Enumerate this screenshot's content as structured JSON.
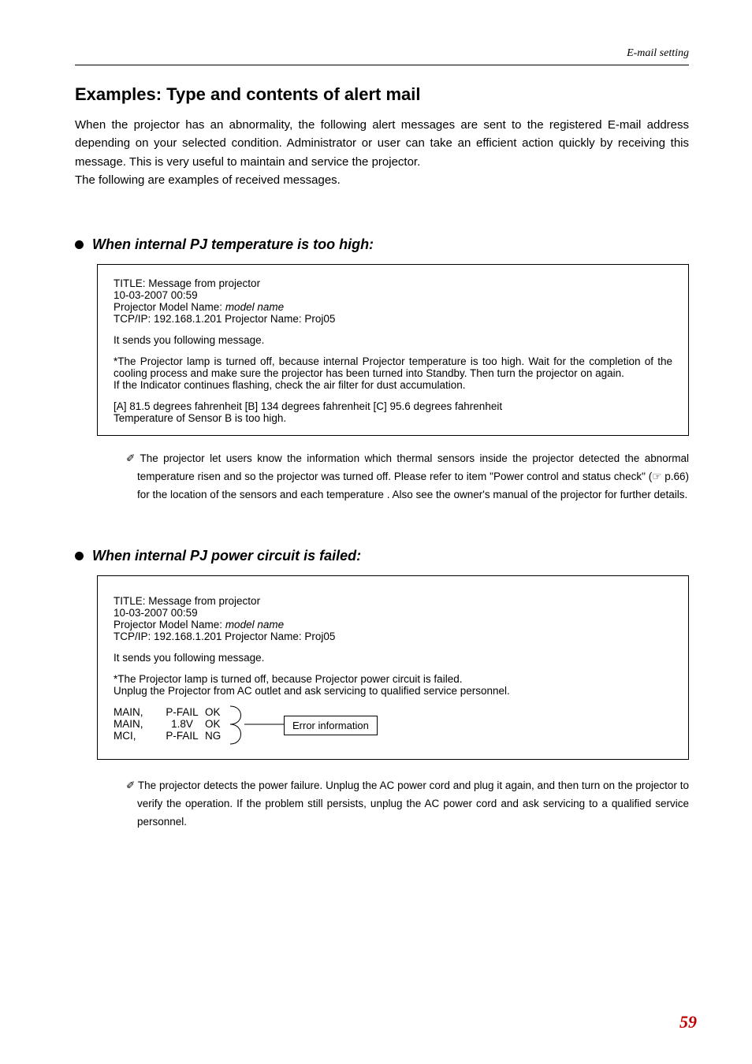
{
  "header": {
    "right_label": "E-mail setting"
  },
  "title": "Examples: Type and contents of alert mail",
  "intro": "When the projector has an abnormality, the following alert messages are sent to the registered E-mail address depending on your selected condition. Administrator or user can take an efficient action quickly by receiving this message. This is very useful to maintain and service the projector.\nThe following are examples of received messages.",
  "section1": {
    "heading": "When internal PJ temperature is too high:",
    "msg_title": "TITLE: Message from projector",
    "timestamp": "10-03-2007 00:59",
    "model_label": "Projector Model Name: ",
    "model_value": "model name",
    "tcpip": "TCP/IP: 192.168.1.201 Projector Name: Proj05",
    "sends": "It sends you following message.",
    "body": "*The Projector lamp is turned off, because internal Projector temperature is too high. Wait for the completion of the cooling process and make sure the projector has been turned into Standby. Then turn the projector on again.\n If the Indicator continues flashing, check the air filter for dust accumulation.",
    "temps": "[A] 81.5 degrees fahrenheit [B] 134 degrees fahrenheit  [C] 95.6 degrees fahrenheit",
    "tempwarn": "Temperature of Sensor B is too high.",
    "note": "✐ The projector let users know the information which thermal sensors inside the projector detected the abnormal temperature risen and so the projector was turned off. Please refer to item \"Power control and status check\" (☞ p.66) for the location of the sensors and each temperature . Also see the owner's manual of the projector for further details."
  },
  "section2": {
    "heading": "When internal PJ power circuit is failed:",
    "msg_title": "TITLE: Message from projector",
    "timestamp": "10-03-2007 00:59",
    "model_label": "Projector Model Name: ",
    "model_value": "model name",
    "tcpip": "TCP/IP: 192.168.1.201 Projector Name: Proj05",
    "sends": "It sends you following message.",
    "body": "*The Projector lamp is turned off, because Projector power circuit is failed.\nUnplug the Projector from AC outlet and ask servicing to qualified service personnel.",
    "rows": [
      {
        "c1": "MAIN,",
        "c2": "P-FAIL",
        "c3": "OK"
      },
      {
        "c1": "MAIN,",
        "c2": "1.8V",
        "c3": "OK"
      },
      {
        "c1": "MCI,",
        "c2": "P-FAIL",
        "c3": "NG"
      }
    ],
    "callout": "Error information",
    "note": "✐ The projector detects the power failure. Unplug the AC power cord and plug it again, and then turn on the projector to verify the operation. If the problem still persists, unplug the AC power cord and ask servicing to a qualified service personnel."
  },
  "page_number": "59"
}
